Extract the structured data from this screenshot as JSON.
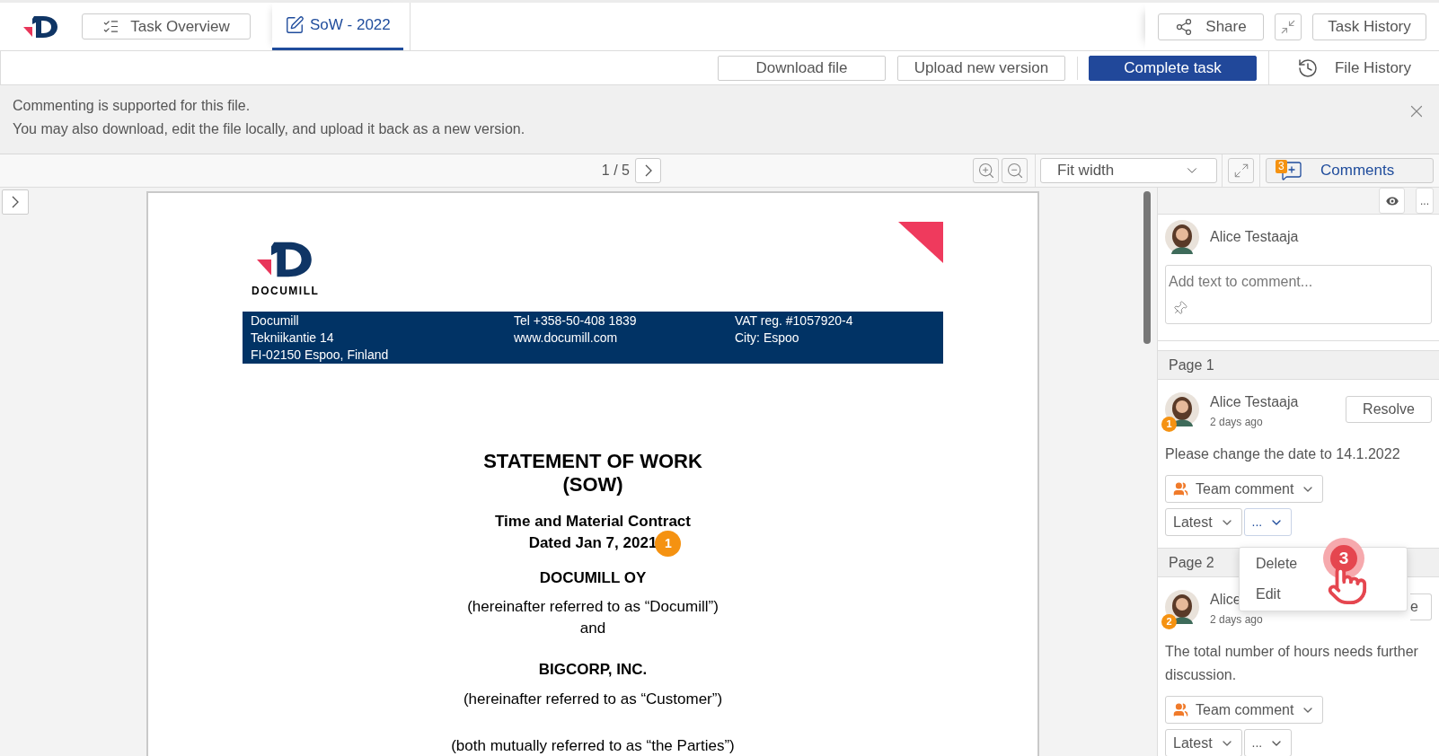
{
  "header": {
    "tabs": [
      {
        "label": "Task Overview",
        "selected": false
      },
      {
        "label": "SoW - 2022",
        "selected": true
      }
    ],
    "share": "Share",
    "task_history": "Task History"
  },
  "action_bar": {
    "buttons": [
      {
        "label": "Download file",
        "primary": false
      },
      {
        "label": "Upload new version",
        "primary": false
      },
      {
        "label": "Complete task",
        "primary": true
      }
    ],
    "file_history": "File History"
  },
  "banner": {
    "lines": [
      "Commenting is supported for this file.",
      "You may also download, edit the file locally, and upload it back as a new version."
    ]
  },
  "viewer_toolbar": {
    "page_indicator": "1 / 5",
    "zoom_select": "Fit width",
    "comments_button": {
      "label": "Comments",
      "count": "3"
    }
  },
  "document": {
    "logo_text": "DOCUMILL",
    "letterhead": [
      [
        "Documill",
        "Tekniikantie 14",
        "FI-02150 Espoo, Finland"
      ],
      [
        "Tel +358-50-408 1839",
        "www.documill.com"
      ],
      [
        "VAT reg. #1057920-4",
        "City: Espoo"
      ]
    ],
    "title": [
      "STATEMENT OF WORK",
      "(SOW)"
    ],
    "paragraphs": [
      {
        "lines": [
          "Time and Material Contract",
          "Dated Jan 7, 2021"
        ],
        "bold": true,
        "marker": "1"
      },
      {
        "lines": [
          "DOCUMILL OY"
        ],
        "bold": true
      },
      {
        "lines": [
          "(hereinafter referred to as “Documill”)",
          "and"
        ],
        "bold": false
      },
      {
        "lines": [
          "BIGCORP, INC."
        ],
        "bold": true
      },
      {
        "lines": [
          "(hereinafter referred to as “Customer”)"
        ],
        "bold": false
      },
      {
        "lines": [
          "(both mutually referred to as “the Parties”)"
        ],
        "bold": false
      }
    ]
  },
  "comments_panel": {
    "more": "...",
    "composer": {
      "author": "Alice Testaaja",
      "placeholder": "Add text to comment..."
    },
    "groups": [
      {
        "page": "Page 1",
        "comments": [
          {
            "marker": "1",
            "author": "Alice Testaaja",
            "time": "2 days ago",
            "resolve": "Resolve",
            "text": "Please change the date to 14.1.2022",
            "visibility": "Team comment",
            "version": "Latest",
            "more": "...",
            "more_open": true
          }
        ]
      },
      {
        "page": "Page 2",
        "comments": [
          {
            "marker": "2",
            "author": "Alice",
            "time": "2 days ago",
            "resolve": "e",
            "text": "The total number of hours needs further discussion.",
            "visibility": "Team comment",
            "version": "Latest",
            "more": "...",
            "more_open": false
          }
        ]
      }
    ],
    "context_menu": [
      "Delete",
      "Edit"
    ],
    "step_marker": "3"
  }
}
